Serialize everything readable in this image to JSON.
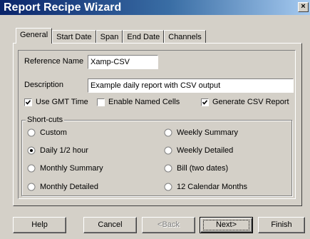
{
  "window": {
    "title": "Report Recipe Wizard",
    "close_glyph": "×"
  },
  "tabs": [
    {
      "label": "General",
      "active": true
    },
    {
      "label": "Start Date",
      "active": false
    },
    {
      "label": "Span",
      "active": false
    },
    {
      "label": "End Date",
      "active": false
    },
    {
      "label": "Channels",
      "active": false
    }
  ],
  "form": {
    "reference_name_label": "Reference Name",
    "reference_name_value": "Xamp-CSV",
    "description_label": "Description",
    "description_value": "Example daily report with CSV output",
    "use_gmt_label": "Use GMT Time",
    "use_gmt_checked": true,
    "named_cells_label": "Enable Named Cells",
    "named_cells_checked": false,
    "csv_label": "Generate CSV Report",
    "csv_checked": true
  },
  "shortcuts": {
    "legend": "Short-cuts",
    "options": [
      {
        "label": "Custom",
        "selected": false
      },
      {
        "label": "Weekly Summary",
        "selected": false
      },
      {
        "label": "Daily 1/2 hour",
        "selected": true
      },
      {
        "label": "Weekly Detailed",
        "selected": false
      },
      {
        "label": "Monthly Summary",
        "selected": false
      },
      {
        "label": "Bill (two dates)",
        "selected": false
      },
      {
        "label": "Monthly Detailed",
        "selected": false
      },
      {
        "label": "12 Calendar Months",
        "selected": false
      }
    ]
  },
  "buttons": {
    "help": "Help",
    "cancel": "Cancel",
    "back": "<Back",
    "next": "Next>",
    "finish": "Finish"
  },
  "colors": {
    "titlebar_start": "#0a246a",
    "titlebar_end": "#a6caf0",
    "face": "#d4d0c8"
  }
}
